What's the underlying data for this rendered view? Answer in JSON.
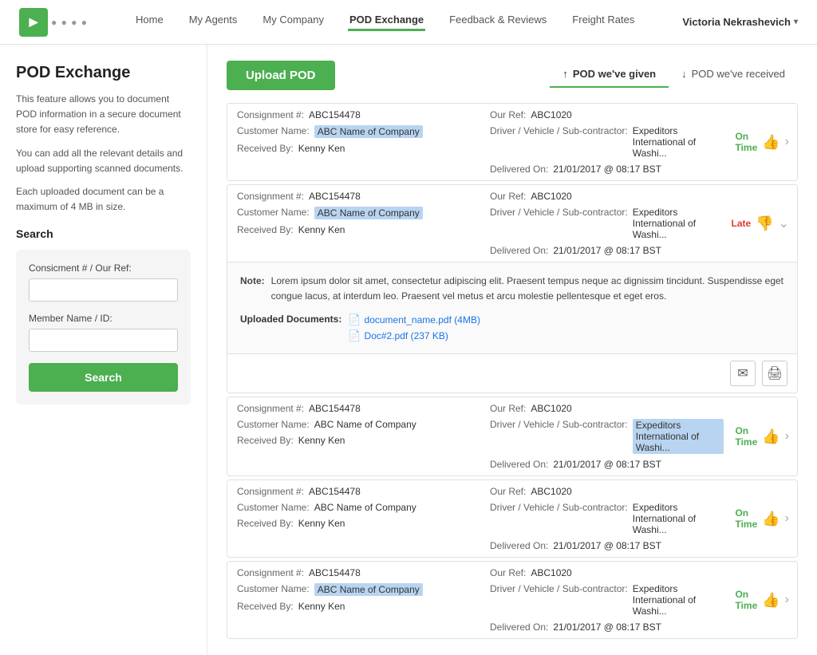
{
  "navbar": {
    "logo_text": "logo",
    "links": [
      {
        "label": "Home",
        "active": false
      },
      {
        "label": "My Agents",
        "active": false
      },
      {
        "label": "My Company",
        "active": false
      },
      {
        "label": "POD Exchange",
        "active": true
      },
      {
        "label": "Feedback & Reviews",
        "active": false
      },
      {
        "label": "Freight Rates",
        "active": false
      }
    ],
    "user_name": "Victoria Nekrashevich"
  },
  "sidebar": {
    "title": "POD Exchange",
    "desc1": "This feature allows you to document POD information in a secure document store for easy reference.",
    "desc2": "You can add all the relevant details and upload supporting scanned documents.",
    "desc3": "Each uploaded document can be a maximum of 4 MB in size.",
    "search_label": "Search",
    "consignment_label": "Consicment # / Our Ref:",
    "consignment_placeholder": "",
    "member_label": "Member Name / ID:",
    "member_placeholder": "",
    "search_button": "Search"
  },
  "main": {
    "upload_pod_label": "Upload POD",
    "tabs": [
      {
        "label": "POD we've given",
        "active": true,
        "icon": "↑"
      },
      {
        "label": "POD we've received",
        "active": false,
        "icon": "↓"
      }
    ],
    "records": [
      {
        "id": 1,
        "consignment_no": "ABC154478",
        "our_ref": "ABC1020",
        "customer_name": "ABC Name of Company",
        "driver_vehicle": "Expeditors International of Washi...",
        "received_by": "Kenny Ken",
        "delivered_on": "21/01/2017 @ 08:17 BST",
        "status": "On Time",
        "status_type": "ontime",
        "expanded": false,
        "highlight_customer": true,
        "highlight_driver": false
      },
      {
        "id": 2,
        "consignment_no": "ABC154478",
        "our_ref": "ABC1020",
        "customer_name": "ABC Name of Company",
        "driver_vehicle": "Expeditors International of Washi...",
        "received_by": "Kenny Ken",
        "delivered_on": "21/01/2017 @ 08:17 BST",
        "status": "Late",
        "status_type": "late",
        "expanded": true,
        "highlight_customer": true,
        "highlight_driver": false,
        "note": "Lorem ipsum dolor sit amet, consectetur adipiscing elit. Praesent tempus neque ac dignissim tincidunt. Suspendisse eget congue lacus, at interdum leo. Praesent vel metus et arcu molestie pellentesque et eget eros.",
        "documents": [
          {
            "name": "document_name.pdf (4MB)"
          },
          {
            "name": "Doc#2.pdf (237 KB)"
          }
        ]
      },
      {
        "id": 3,
        "consignment_no": "ABC154478",
        "our_ref": "ABC1020",
        "customer_name": "ABC Name of Company",
        "driver_vehicle": "Expeditors International of Washi...",
        "received_by": "Kenny Ken",
        "delivered_on": "21/01/2017 @ 08:17 BST",
        "status": "On Time",
        "status_type": "ontime",
        "expanded": false,
        "highlight_customer": false,
        "highlight_driver": true
      },
      {
        "id": 4,
        "consignment_no": "ABC154478",
        "our_ref": "ABC1020",
        "customer_name": "ABC Name of Company",
        "driver_vehicle": "Expeditors International of Washi...",
        "received_by": "Kenny Ken",
        "delivered_on": "21/01/2017 @ 08:17 BST",
        "status": "On Time",
        "status_type": "ontime",
        "expanded": false,
        "highlight_customer": false,
        "highlight_driver": false
      },
      {
        "id": 5,
        "consignment_no": "ABC154478",
        "our_ref": "ABC1020",
        "customer_name": "ABC Name of Company",
        "driver_vehicle": "Expeditors International of Washi...",
        "received_by": "Kenny Ken",
        "delivered_on": "21/01/2017 @ 08:17 BST",
        "status": "On Time",
        "status_type": "ontime",
        "expanded": false,
        "highlight_customer": true,
        "highlight_driver": false
      }
    ],
    "note_label": "Note:",
    "uploaded_docs_label": "Uploaded Documents:",
    "email_icon": "✉",
    "print_icon": "🖨"
  }
}
